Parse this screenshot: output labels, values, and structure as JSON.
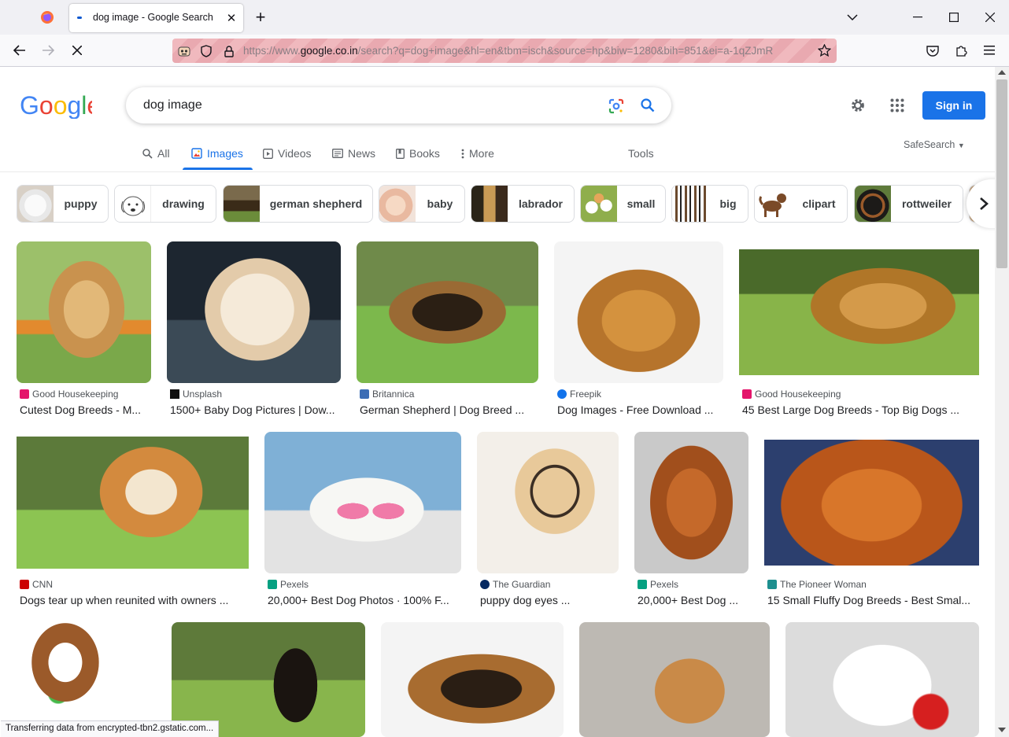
{
  "browser": {
    "tab_title": "dog image - Google Search",
    "new_tab": "+",
    "url_prefix": "https://www.",
    "url_host": "google.co.in",
    "url_rest": "/search?q=dog+image&hl=en&tbm=isch&source=hp&biw=1280&bih=851&ei=a-1qZJmR",
    "status_text": "Transferring data from encrypted-tbn2.gstatic.com..."
  },
  "google": {
    "logo": "Google",
    "query": "dog image",
    "sign_in": "Sign in",
    "safesearch": "SafeSearch",
    "tools": "Tools",
    "tabs": [
      {
        "label": "All"
      },
      {
        "label": "Images"
      },
      {
        "label": "Videos"
      },
      {
        "label": "News"
      },
      {
        "label": "Books"
      },
      {
        "label": "More"
      }
    ],
    "chips": [
      {
        "label": "puppy"
      },
      {
        "label": "drawing"
      },
      {
        "label": "german shepherd"
      },
      {
        "label": "baby"
      },
      {
        "label": "labrador"
      },
      {
        "label": "small"
      },
      {
        "label": "big"
      },
      {
        "label": "clipart"
      },
      {
        "label": "rottweiler"
      }
    ],
    "results": [
      {
        "source": "Good Housekeeping",
        "title": "Cutest Dog Breeds - M..."
      },
      {
        "source": "Unsplash",
        "title": "1500+ Baby Dog Pictures | Dow..."
      },
      {
        "source": "Britannica",
        "title": "German Shepherd | Dog Breed ..."
      },
      {
        "source": "Freepik",
        "title": "Dog Images - Free Download ..."
      },
      {
        "source": "Good Housekeeping",
        "title": "45 Best Large Dog Breeds - Top Big Dogs ..."
      },
      {
        "source": "CNN",
        "title": "Dogs tear up when reunited with owners ..."
      },
      {
        "source": "Pexels",
        "title": "20,000+ Best Dog Photos · 100% F..."
      },
      {
        "source": "The Guardian",
        "title": "puppy dog eyes ..."
      },
      {
        "source": "Pexels",
        "title": "20,000+ Best Dog ..."
      },
      {
        "source": "The Pioneer Woman",
        "title": "15 Small Fluffy Dog Breeds - Best Smal..."
      }
    ]
  },
  "colors": {
    "accent": "#1a73e8",
    "google_blue": "#4285f4",
    "google_red": "#ea4335",
    "google_yellow": "#fbbc05",
    "google_green": "#34a853"
  }
}
